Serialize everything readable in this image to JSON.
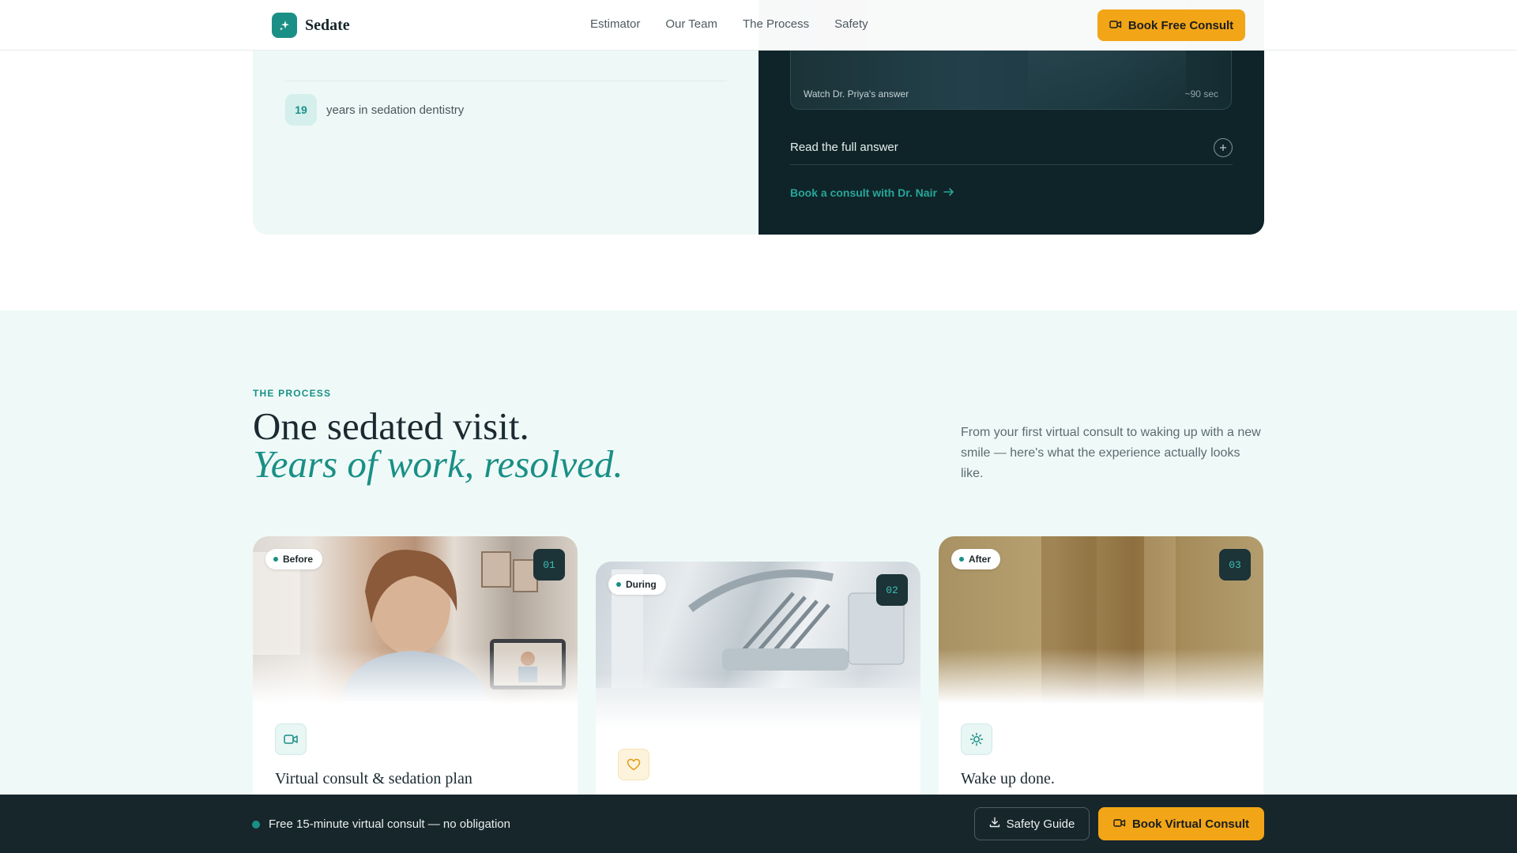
{
  "header": {
    "brand": "Sedate",
    "nav": [
      "Estimator",
      "Our Team",
      "The Process",
      "Safety"
    ],
    "cta_label": "Book Free Consult"
  },
  "doctor_panel": {
    "stat_value": "19",
    "stat_label": "years in sedation dentistry",
    "video_caption": "Watch Dr. Priya's answer",
    "video_duration": "~90 sec",
    "read_more_label": "Read the full answer",
    "consult_link": "Book a consult with Dr. Nair"
  },
  "process": {
    "eyebrow": "THE PROCESS",
    "title_line1": "One sedated visit.",
    "title_line2": "Years of work, resolved.",
    "intro": "From your first virtual consult to waking up with a new smile — here's what the experience actually looks like.",
    "cards": [
      {
        "tag": "Before",
        "number": "01",
        "icon": "video-icon",
        "title": "Virtual consult & sedation plan"
      },
      {
        "tag": "During",
        "number": "02",
        "icon": "heart-icon",
        "title": ""
      },
      {
        "tag": "After",
        "number": "03",
        "icon": "sun-icon",
        "title": "Wake up done."
      }
    ]
  },
  "bottom_bar": {
    "message": "Free 15-minute virtual consult — no obligation",
    "secondary_label": "Safety Guide",
    "primary_label": "Book Virtual Consult"
  },
  "colors": {
    "accent": "#1a8f86",
    "cta": "#f2a516",
    "dark_panel": "#0f2428",
    "section_bg": "#effaf8",
    "bottom_bar": "#17262b"
  }
}
